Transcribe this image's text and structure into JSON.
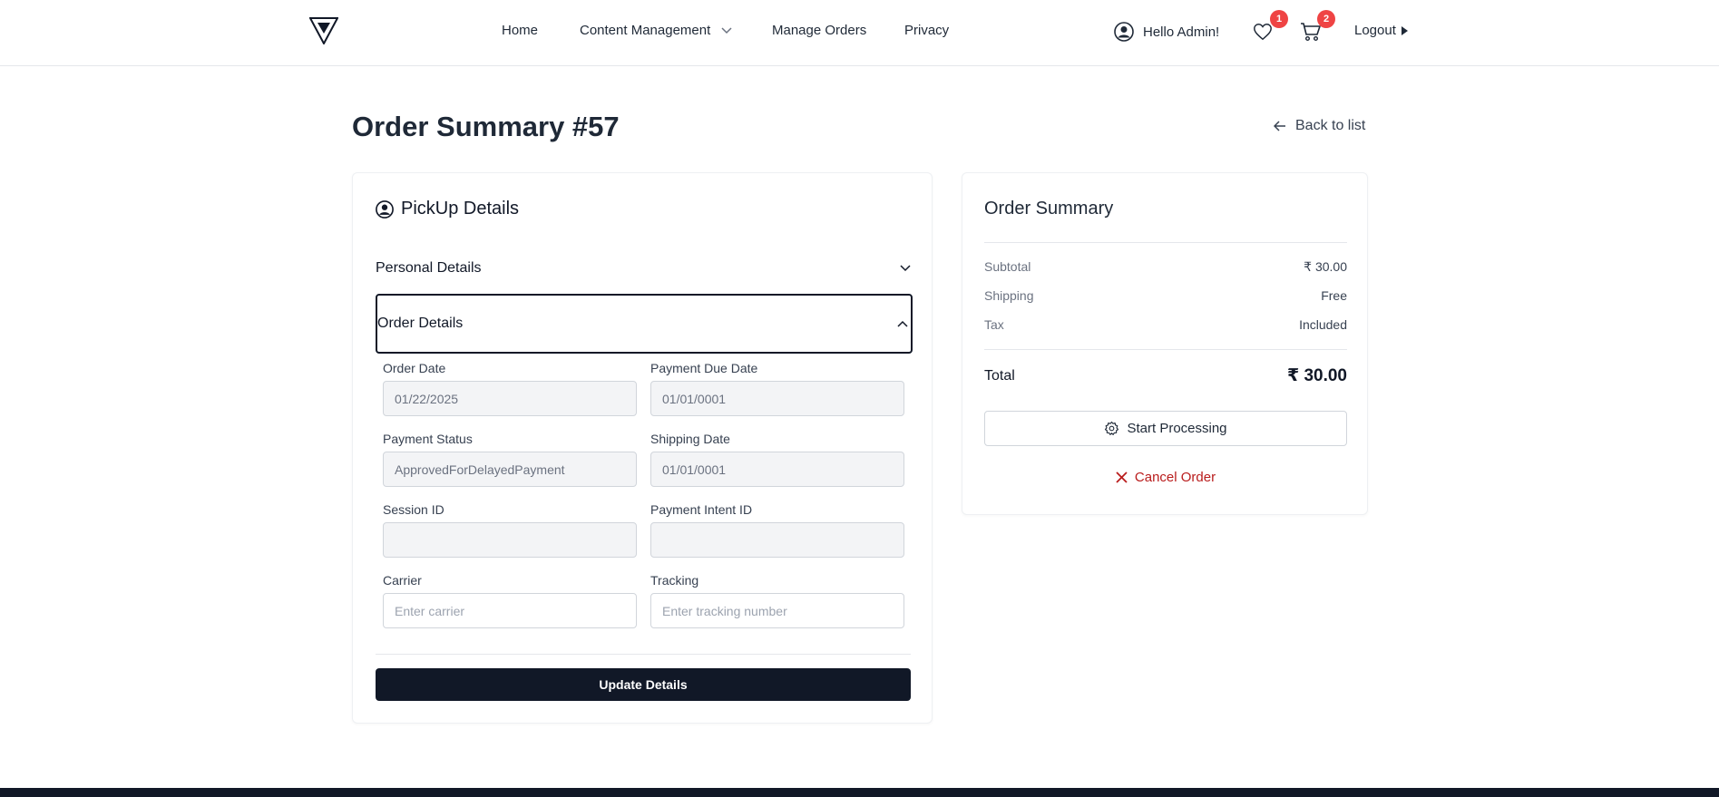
{
  "nav": {
    "links": {
      "home": "Home",
      "content_management": "Content Management",
      "manage_orders": "Manage Orders",
      "privacy": "Privacy"
    },
    "user_greeting": "Hello Admin!",
    "wishlist_count": "1",
    "cart_count": "2",
    "logout": "Logout"
  },
  "header": {
    "title": "Order Summary #57",
    "back_link": "Back to list"
  },
  "pickup": {
    "title": "PickUp Details",
    "personal_details": "Personal Details",
    "order_details": "Order Details",
    "fields": {
      "order_date": {
        "label": "Order Date",
        "value": "01/22/2025"
      },
      "payment_due_date": {
        "label": "Payment Due Date",
        "value": "01/01/0001"
      },
      "payment_status": {
        "label": "Payment Status",
        "value": "ApprovedForDelayedPayment"
      },
      "shipping_date": {
        "label": "Shipping Date",
        "value": "01/01/0001"
      },
      "session_id": {
        "label": "Session ID",
        "value": ""
      },
      "payment_intent_id": {
        "label": "Payment Intent ID",
        "value": ""
      },
      "carrier": {
        "label": "Carrier",
        "value": "",
        "placeholder": "Enter carrier"
      },
      "tracking": {
        "label": "Tracking",
        "value": "",
        "placeholder": "Enter tracking number"
      }
    },
    "update_button": "Update Details"
  },
  "order_summary": {
    "title": "Order Summary",
    "subtotal_label": "Subtotal",
    "subtotal_value": "₹ 30.00",
    "shipping_label": "Shipping",
    "shipping_value": "Free",
    "tax_label": "Tax",
    "tax_value": "Included",
    "total_label": "Total",
    "total_value": "₹ 30.00",
    "start_processing": "Start Processing",
    "cancel_order": "Cancel Order"
  },
  "colors": {
    "primary_dark": "#111827",
    "badge_red": "#ef4444",
    "cancel_red": "#b91c1c"
  }
}
